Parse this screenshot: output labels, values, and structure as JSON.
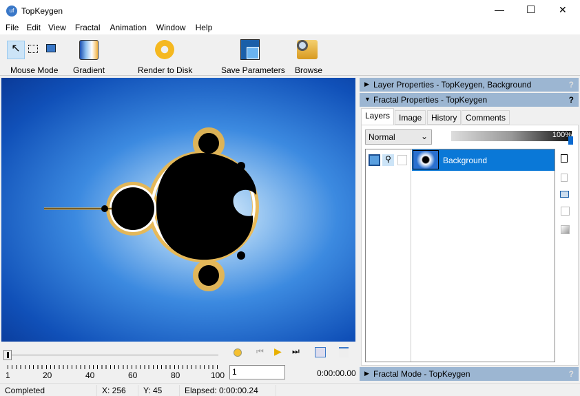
{
  "window": {
    "title": "TopKeygen",
    "controls": [
      "—",
      "☐",
      "✕"
    ]
  },
  "menu": [
    "File",
    "Edit",
    "View",
    "Fractal",
    "Animation",
    "Window",
    "Help"
  ],
  "toolbar": {
    "mouse_mode": "Mouse Mode",
    "gradient": "Gradient",
    "render": "Render to Disk",
    "save": "Save Parameters",
    "browse": "Browse"
  },
  "panels": {
    "layer_props": "Layer Properties - TopKeygen, Background",
    "fractal_props": "Fractal Properties - TopKeygen",
    "fractal_mode": "Fractal Mode - TopKeygen",
    "help": "?"
  },
  "tabs": [
    "Layers",
    "Image",
    "History",
    "Comments"
  ],
  "layers": {
    "blend_mode": "Normal",
    "opacity": "100%",
    "opacity_value": 100,
    "items": [
      {
        "name": "Background"
      }
    ]
  },
  "timeline": {
    "ticks": [
      "1",
      "20",
      "40",
      "60",
      "80",
      "100"
    ],
    "frame": "1",
    "time": "0:00:00.00"
  },
  "status": {
    "state": "Completed",
    "x": "X: 256",
    "y": "Y: 45",
    "elapsed": "Elapsed: 0:00:00.24"
  }
}
